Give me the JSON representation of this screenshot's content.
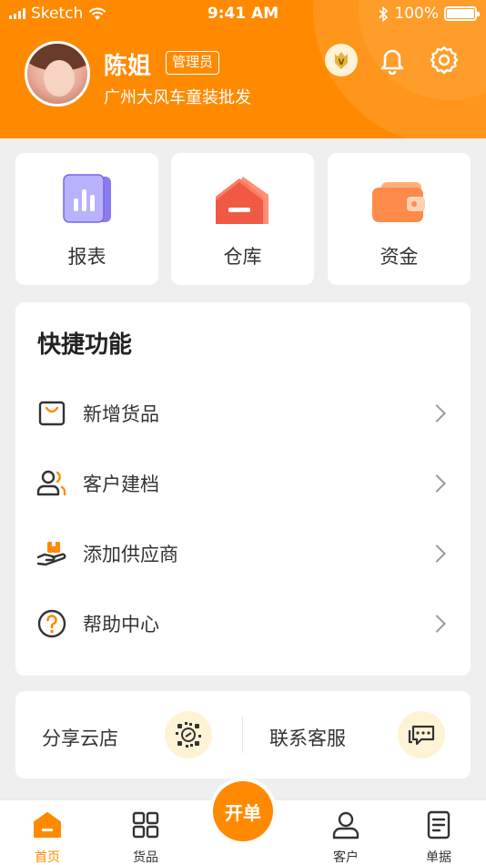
{
  "status_bar": {
    "carrier": "Sketch",
    "time": "9:41 AM",
    "battery": "100%"
  },
  "header": {
    "user_name": "陈姐",
    "role": "管理员",
    "shop_name": "广州大风车童装批发",
    "vip_letter": "V"
  },
  "entries": [
    {
      "label": "报表",
      "icon": "report-icon"
    },
    {
      "label": "仓库",
      "icon": "warehouse-icon"
    },
    {
      "label": "资金",
      "icon": "wallet-icon"
    }
  ],
  "shortcuts": {
    "title": "快捷功能",
    "items": [
      {
        "label": "新增货品",
        "icon": "shopping-bag-icon"
      },
      {
        "label": "客户建档",
        "icon": "users-icon"
      },
      {
        "label": "添加供应商",
        "icon": "hand-box-icon"
      },
      {
        "label": "帮助中心",
        "icon": "help-icon"
      }
    ]
  },
  "share": {
    "share_label": "分享云店",
    "service_label": "联系客服"
  },
  "tabbar": {
    "tabs": [
      {
        "label": "首页",
        "icon": "home-icon",
        "active": true
      },
      {
        "label": "货品",
        "icon": "grid-icon",
        "active": false
      },
      {
        "label": "客户",
        "icon": "user-icon",
        "active": false
      },
      {
        "label": "单据",
        "icon": "document-icon",
        "active": false
      }
    ],
    "fab_label": "开单"
  },
  "colors": {
    "accent": "#ff8a00",
    "background": "#efefef"
  }
}
